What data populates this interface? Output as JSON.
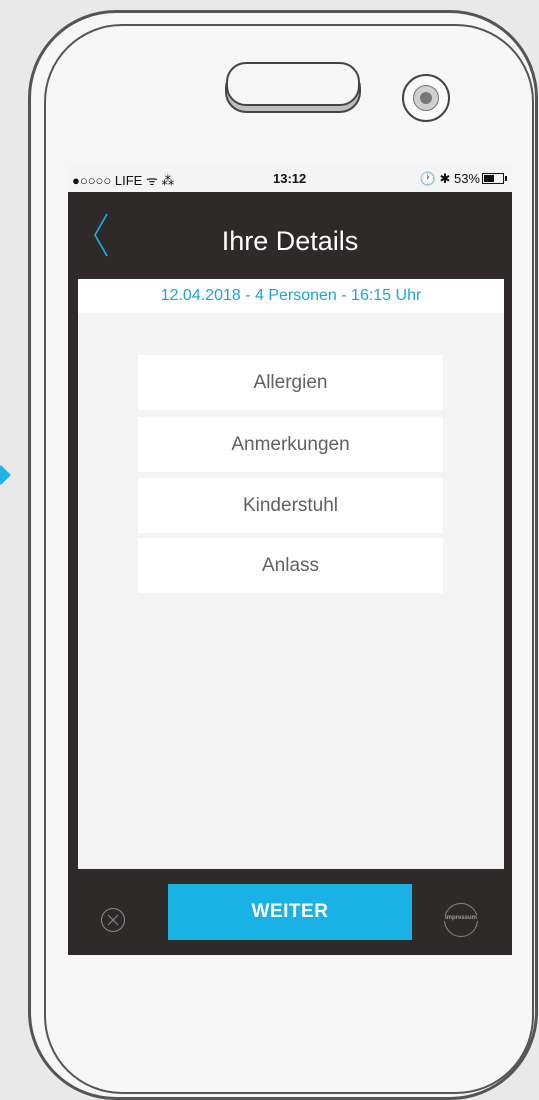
{
  "statusbar": {
    "carrier": "●○○○○ LIFE ᯤ ⁂",
    "time": "13:12",
    "battery": "🕐 ✱ 53%"
  },
  "header": {
    "title": "Ihre Details"
  },
  "reservation": {
    "summary": "12.04.2018 - 4 Personen - 16:15 Uhr"
  },
  "options": [
    {
      "label": "Allergien"
    },
    {
      "label": "Anmerkungen"
    },
    {
      "label": "Kinderstuhl"
    },
    {
      "label": "Anlass"
    }
  ],
  "footer": {
    "next_label": "WEITER",
    "impressum_label": "Impressum"
  },
  "colors": {
    "accent": "#1ab2e5",
    "dark": "#2d2a29",
    "background": "#f3f3f3"
  }
}
